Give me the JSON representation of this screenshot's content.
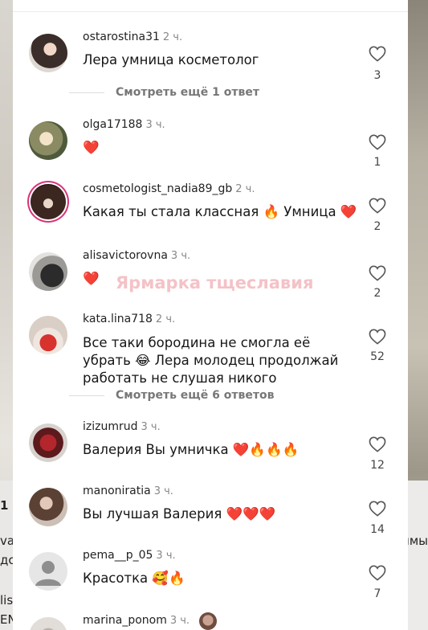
{
  "background": {
    "left_fragments": [
      "1 1",
      "va",
      "дст",
      "lis",
      "EN"
    ],
    "right_fragments": [
      "ммы"
    ]
  },
  "watermark": "Ярмарка тщеславия",
  "comments": [
    {
      "user": "ostarostina31",
      "time": "2 ч.",
      "text": "Лера умница косметолог",
      "likes": "3",
      "more": "Смотреть ещё 1 ответ"
    },
    {
      "user": "olga17188",
      "time": "3 ч.",
      "text": "❤️",
      "likes": "1"
    },
    {
      "user": "cosmetologist_nadia89_gb",
      "time": "2 ч.",
      "text": "Какая ты стала классная 🔥 Умница ❤️",
      "likes": "2"
    },
    {
      "user": "alisavictorovna",
      "time": "3 ч.",
      "text": "❤️",
      "likes": "2"
    },
    {
      "user": "kata.lina718",
      "time": "2 ч.",
      "text": "Все таки бородина не смогла её убрать 😂 Лера молодец продолжай работать не слушая никого",
      "likes": "52",
      "more": "Смотреть ещё 6 ответов"
    },
    {
      "user": "izizumrud",
      "time": "3 ч.",
      "text": "Валерия Вы умничка ❤️🔥🔥🔥",
      "likes": "12"
    },
    {
      "user": "manoniratia",
      "time": "3 ч.",
      "text": "Вы лучшая Валерия ❤️❤️❤️",
      "likes": "14"
    },
    {
      "user": "pema__p_05",
      "time": "3 ч.",
      "text": "Красотка 🥰🔥",
      "likes": "7"
    },
    {
      "user": "marina_ponom",
      "time": "3 ч.",
      "text": "",
      "likes": ""
    }
  ],
  "colors": {
    "heart_outline": "#555555",
    "story_ring": "#d8337a",
    "text": "#161616",
    "meta": "#888888"
  },
  "icons": [
    "heart-outline-icon"
  ]
}
